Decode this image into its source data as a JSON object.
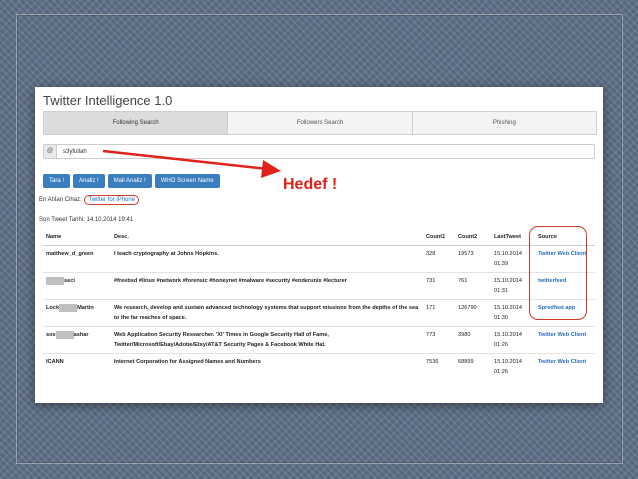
{
  "app": {
    "title": "Twitter Intelligence 1.0"
  },
  "tabs": [
    {
      "label": "Following Search"
    },
    {
      "label": "Followers Search"
    },
    {
      "label": "Phishing"
    }
  ],
  "search": {
    "prefix": "@",
    "value": "s3yfullah"
  },
  "buttons": [
    {
      "label": "Tara !"
    },
    {
      "label": "Analiz !"
    },
    {
      "label": "Mail Analiz !"
    },
    {
      "label": "WHO Screen Name"
    }
  ],
  "annotation": {
    "text": "Hedef !",
    "color": "#e0231a"
  },
  "device": {
    "label": "En Atılan Cihaz:",
    "value": "Twitter for iPhone"
  },
  "last_tweet": {
    "label": "Son Tweet Tarihi:",
    "value": "14.10.2014 19:41"
  },
  "table": {
    "headers": [
      "Name",
      "Desc.",
      "Count1",
      "Count2",
      "LastTweet",
      "Source"
    ],
    "rows": [
      {
        "name_pre": "matthew_d_green",
        "name_post": "",
        "blurred": false,
        "desc": "I teach cryptography at Johns Hopkins.",
        "count1": "328",
        "count2": "19573",
        "last": "15.10.2014 01:39",
        "source": "Twitter Web Client"
      },
      {
        "name_pre": "",
        "name_post": "seci",
        "blurred": true,
        "desc": "#freebsd #linux #network #forensic #honeynet #malware #security #enderunix #lecturer",
        "count1": "731",
        "count2": "761",
        "last": "15.10.2014 01:31",
        "source": "twitterfeed"
      },
      {
        "name_pre": "Lock",
        "name_post": "Martin",
        "blurred": true,
        "desc": "We research, develop and sustain advanced technology systems that support missions from the depths of the sea to the far reaches of space.",
        "count1": "171",
        "count2": "126790",
        "last": "15.10.2014 01:30",
        "source": "Spredfast app"
      },
      {
        "name_pre": "sos",
        "name_post": "ashar",
        "blurred": true,
        "desc": "Web Application Security Researcher. 'XI' Times in Google Security Hall of Fame, Twitter/Microsoft/Ebay/Adobe/Etsy/AT&T Security Pages & Facebook White Hat.",
        "count1": "773",
        "count2": "3980",
        "last": "15.10.2014 01:26",
        "source": "Twitter Web Client"
      },
      {
        "name_pre": "ICANN",
        "name_post": "",
        "blurred": false,
        "desc": "Internet Corporation for Assigned Names and Numbers",
        "count1": "7536",
        "count2": "68899",
        "last": "15.10.2014 01:26",
        "source": "Twitter Web Client"
      }
    ]
  }
}
